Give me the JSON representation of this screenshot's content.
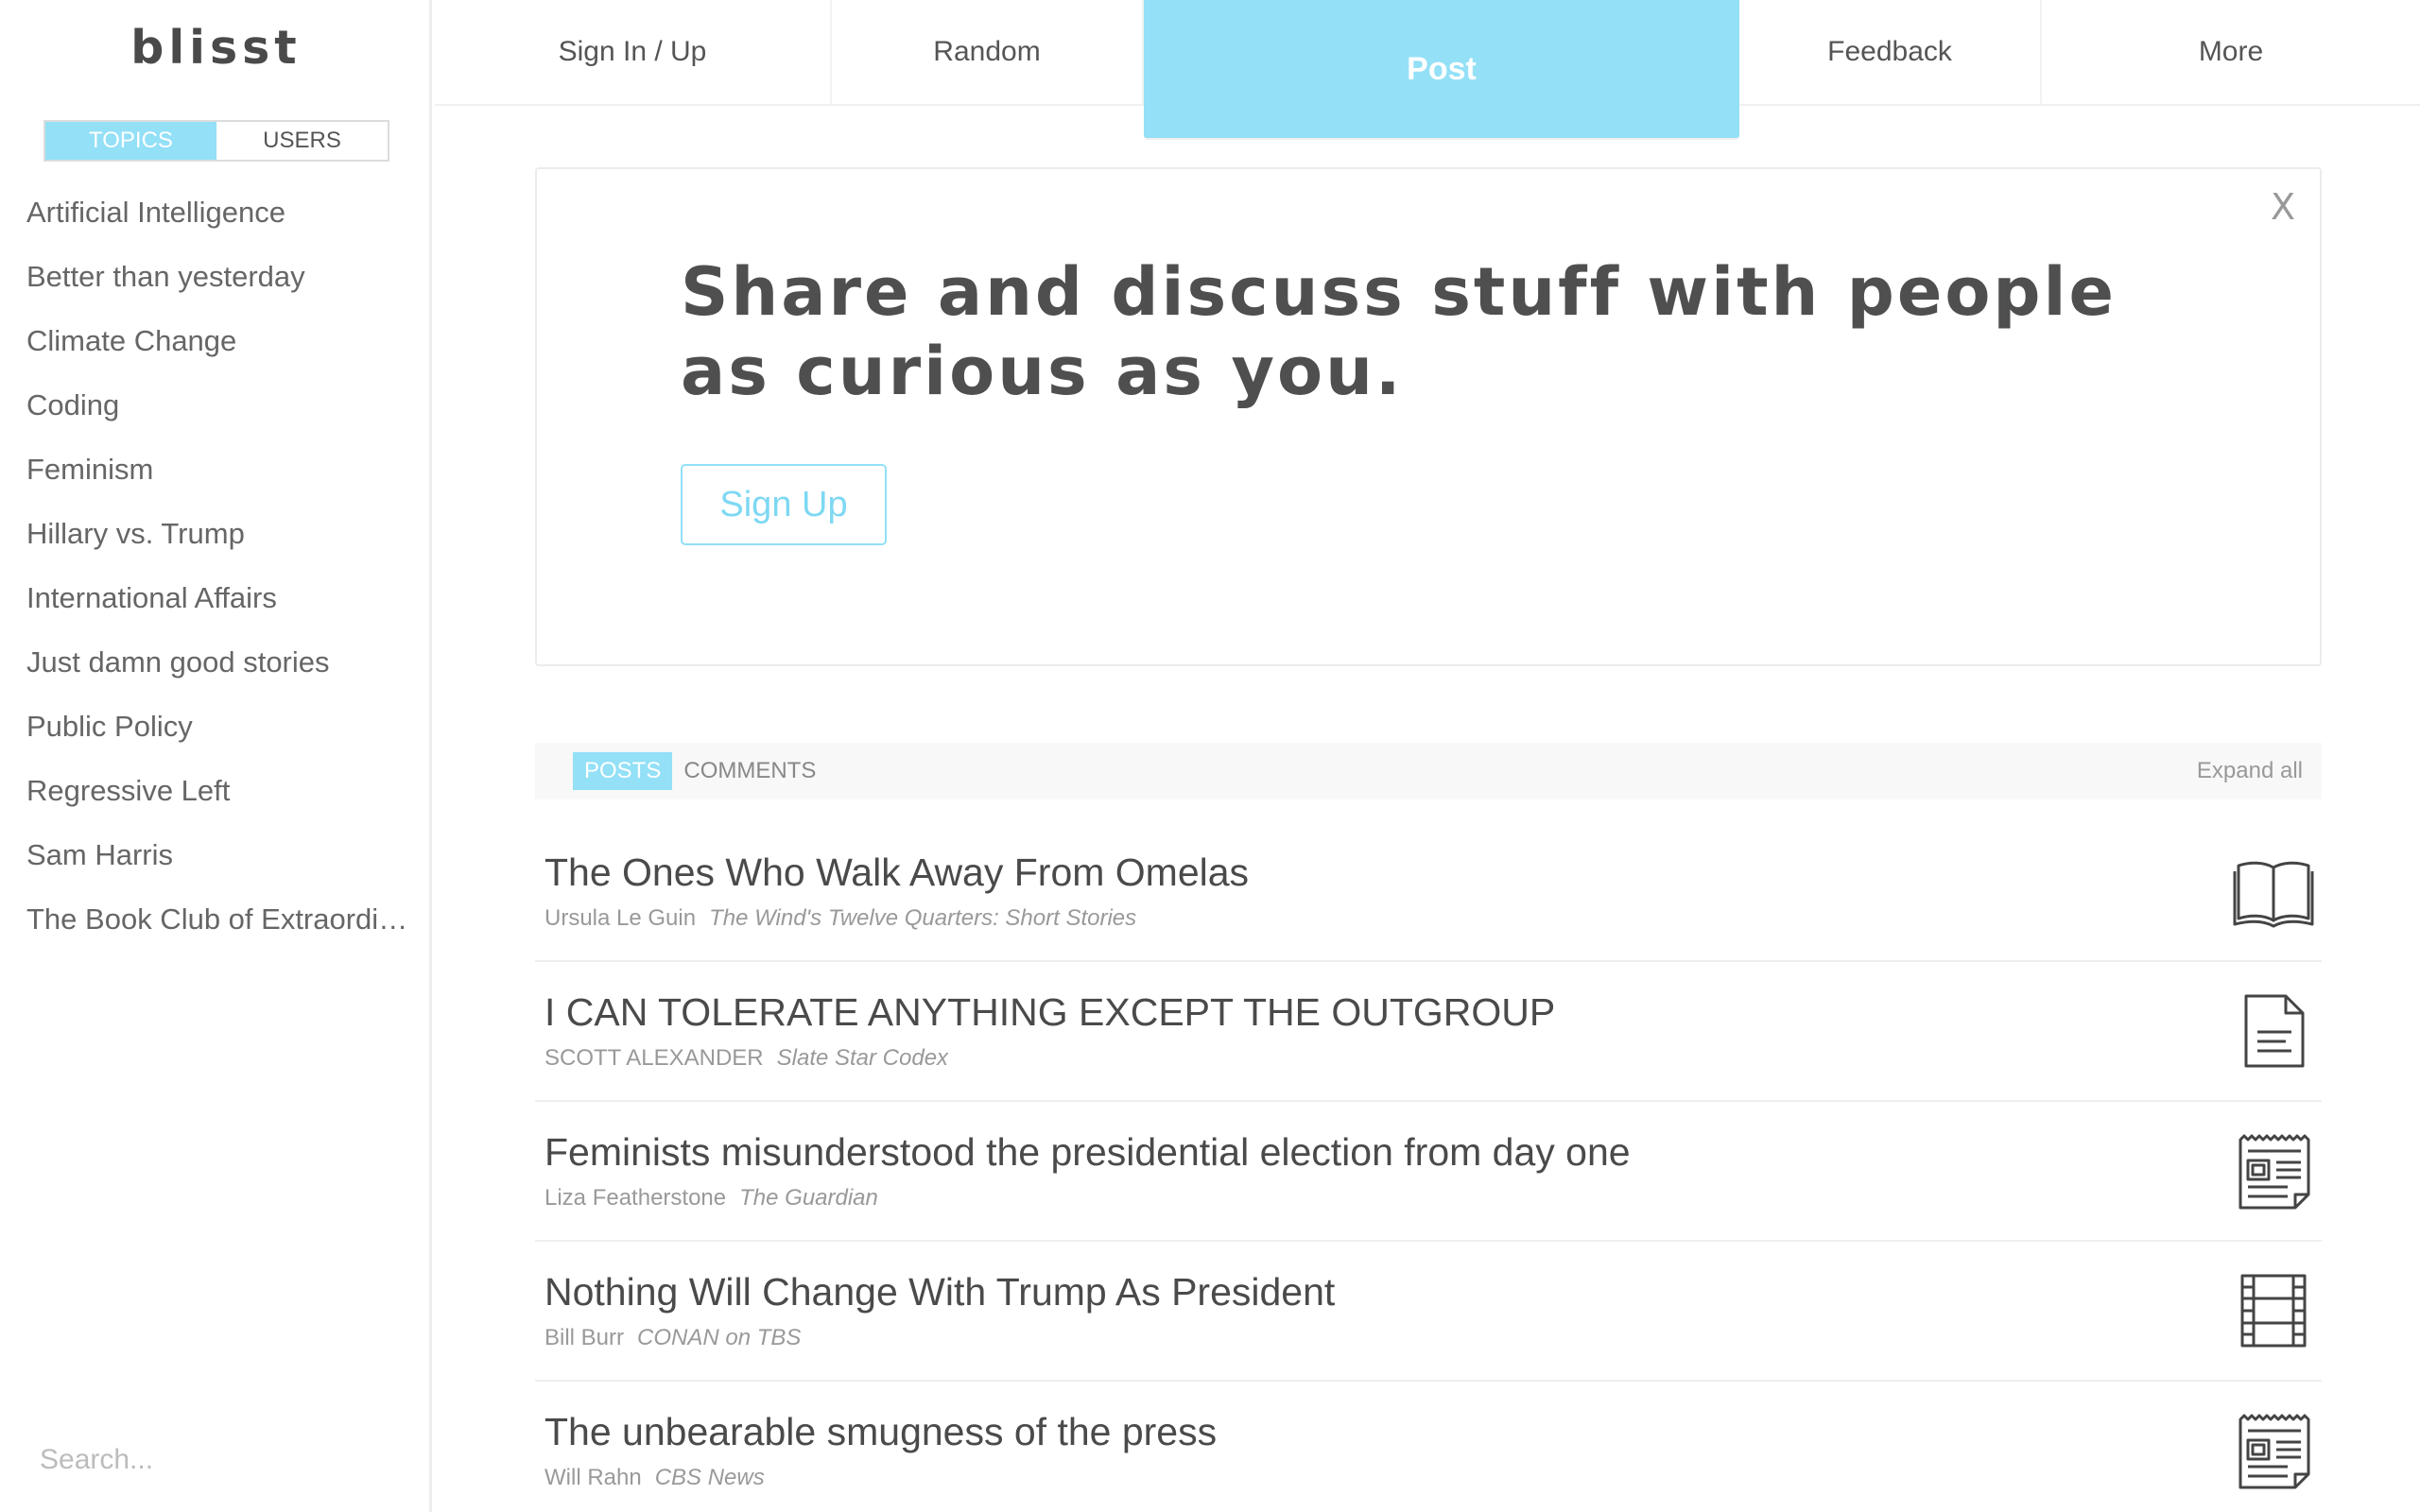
{
  "sidebar": {
    "logo": "blisst",
    "tabs": {
      "topics": "TOPICS",
      "users": "USERS"
    },
    "topics": [
      "Artificial Intelligence",
      "Better than yesterday",
      "Climate Change",
      "Coding",
      "Feminism",
      "Hillary vs. Trump",
      "International Affairs",
      "Just damn good stories",
      "Public Policy",
      "Regressive Left",
      "Sam Harris",
      "The Book Club of Extraordinary Ideas"
    ],
    "search_placeholder": "Search..."
  },
  "nav": {
    "signin": "Sign In / Up",
    "random": "Random",
    "post": "Post",
    "feedback": "Feedback",
    "more": "More"
  },
  "hero": {
    "title": "Share and discuss stuff with people as curious as you.",
    "signup": "Sign Up",
    "close": "X"
  },
  "list_tabs": {
    "posts": "POSTS",
    "comments": "COMMENTS",
    "expand": "Expand all"
  },
  "posts": [
    {
      "title": "The Ones Who Walk Away From Omelas",
      "author": "Ursula Le Guin",
      "source": "The Wind's Twelve Quarters: Short Stories",
      "icon": "book-icon"
    },
    {
      "title": "I CAN TOLERATE ANYTHING EXCEPT THE OUTGROUP",
      "author": "SCOTT ALEXANDER",
      "source": "Slate Star Codex",
      "icon": "document-icon"
    },
    {
      "title": "Feminists misunderstood the presidential election from day one",
      "author": "Liza Featherstone",
      "source": "The Guardian",
      "icon": "newspaper-icon"
    },
    {
      "title": "Nothing Will Change With Trump As President",
      "author": "Bill Burr",
      "source": "CONAN on TBS",
      "icon": "film-icon"
    },
    {
      "title": "The unbearable smugness of the press",
      "author": "Will Rahn",
      "source": "CBS News",
      "icon": "newspaper-icon"
    }
  ],
  "colors": {
    "accent": "#93e0f7",
    "text": "#4a4a4a",
    "muted": "#999999"
  }
}
